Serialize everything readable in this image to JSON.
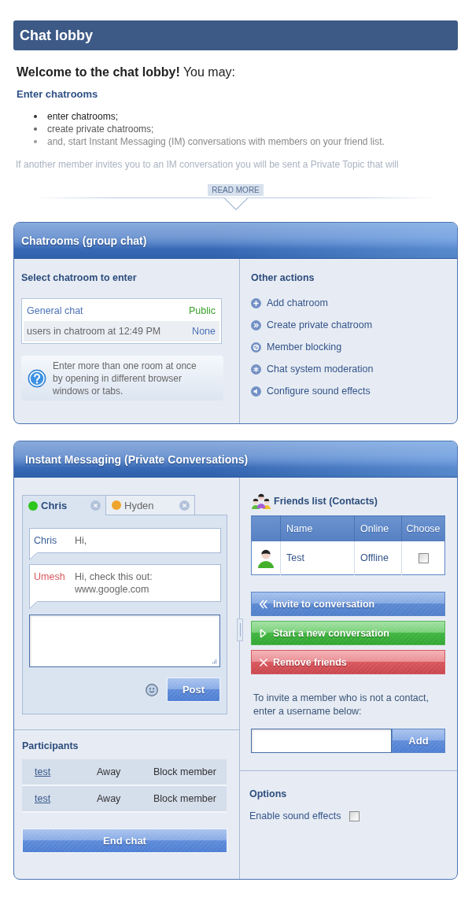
{
  "page": {
    "title": "Chat lobby"
  },
  "intro": {
    "welcome": "**Welcome to the chat lobby!** You may:",
    "heading": "Enter chatrooms",
    "bullets": [
      "enter chatrooms;",
      "create private chatrooms;",
      "and, start Instant Messaging (IM) conversations with members on your friend list."
    ],
    "more_text": "If another member invites you to an IM conversation you will be sent a Private Topic that will",
    "read_more": "READ MORE"
  },
  "chatrooms": {
    "title": "Chatrooms (group chat)",
    "select_heading": "Select chatroom to enter",
    "room": {
      "name": "General chat",
      "access": "Public",
      "users_label": "users in chatroom at 12:49 PM",
      "users": "None"
    },
    "tip": "Enter more than one room at once by opening in different browser windows or tabs.",
    "actions_heading": "Other actions",
    "actions": [
      {
        "kind": "add",
        "label": "Add chatroom"
      },
      {
        "kind": "private",
        "label": "Create private chatroom"
      },
      {
        "kind": "block",
        "label": "Member blocking"
      },
      {
        "kind": "moderation",
        "label": "Chat system moderation"
      },
      {
        "kind": "sound",
        "label": "Configure sound effects"
      }
    ]
  },
  "im": {
    "title": "Instant Messaging (Private Conversations)",
    "tabs": [
      {
        "label": "Chris",
        "selected": true,
        "color": "#2ec51c"
      },
      {
        "label": "Hyden",
        "selected": false,
        "color": "#efa52d"
      }
    ],
    "messages": [
      {
        "sender": "Chris",
        "text": "Hi,",
        "color": "#3b5f96"
      },
      {
        "sender": "Umesh",
        "text": "Hi, check this out: www.google.com",
        "color": "#d9575d"
      }
    ],
    "post": "Post",
    "participants_heading": "Participants",
    "participants": [
      {
        "name": "test",
        "status": "Away",
        "action": "Block member"
      },
      {
        "name": "test",
        "status": "Away",
        "action": "Block member"
      }
    ],
    "end_chat": "End chat"
  },
  "friends": {
    "title": "Friends list (Contacts)",
    "columns": [
      "Name",
      "Online",
      "Choose"
    ],
    "rows": [
      {
        "name": "Test",
        "online": "Offline",
        "checked": false
      }
    ],
    "buttons": [
      {
        "kind": "invite",
        "label": "Invite to conversation"
      },
      {
        "kind": "start",
        "label": "Start a new conversation"
      },
      {
        "kind": "remove",
        "label": "Remove friends"
      }
    ],
    "invite_text": "To invite a member who is not a contact, enter a username below:",
    "add": "Add"
  },
  "options": {
    "title": "Options",
    "items": [
      {
        "label": "Enable sound effects",
        "checked": false
      }
    ]
  }
}
